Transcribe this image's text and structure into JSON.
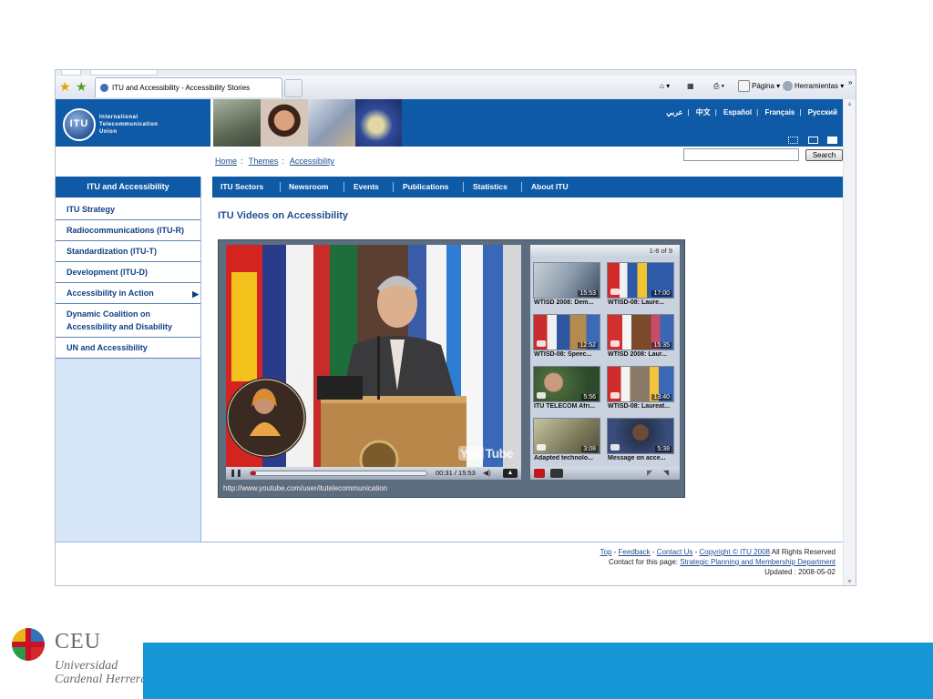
{
  "browser": {
    "tab_title": "ITU and Accessibility - Accessibility Stories",
    "commands": {
      "home": "⌂",
      "feeds": "▦",
      "print": "⎙",
      "page": "Página",
      "tools": "Herramientas",
      "more": "»"
    }
  },
  "itu": {
    "org_name_lines": [
      "International",
      "Telecommunication",
      "Union"
    ],
    "logo_text": "ITU",
    "languages": [
      "عربي",
      "中文",
      "Español",
      "Français",
      "Русский"
    ],
    "search": {
      "placeholder": "",
      "button": "Search"
    },
    "breadcrumb": [
      "Home",
      "Themes",
      "Accessibility"
    ],
    "left_nav": {
      "heading": "ITU and Accessibility",
      "items": [
        "ITU Strategy",
        "Radiocommunications (ITU-R)",
        "Standardization (ITU-T)",
        "Development (ITU-D)",
        "Accessibility in Action",
        "Dynamic Coalition on Accessibility and Disability",
        "UN and Accessibility"
      ]
    },
    "top_nav": [
      "ITU Sectors",
      "Newsroom",
      "Events",
      "Publications",
      "Statistics",
      "About ITU"
    ],
    "page_title": "ITU Videos on Accessibility"
  },
  "player": {
    "time": "00:31 / 15:53",
    "progress": 0.03,
    "brand": "You",
    "brand2": "Tube",
    "url": "http://www.youtube.com/user/itutelecommunication",
    "playlist_count": "1-8 of 9",
    "videos": [
      {
        "caption": "WTISD 2008: Dem...",
        "duration": "15:53"
      },
      {
        "caption": "WTISD-08: Laure...",
        "duration": "17:00"
      },
      {
        "caption": "WTISD-08: Speec...",
        "duration": "12:52"
      },
      {
        "caption": "WTISD 2008: Laur...",
        "duration": "15:35"
      },
      {
        "caption": "ITU TELECOM Afri...",
        "duration": "5:56"
      },
      {
        "caption": "WTISD-08: Laureat...",
        "duration": "13:40"
      },
      {
        "caption": "Adapted technolo...",
        "duration": "3:08"
      },
      {
        "caption": "Message on acce...",
        "duration": "5:38"
      }
    ]
  },
  "footer": {
    "links": [
      "Top",
      "Feedback",
      "Contact Us",
      "Copyright © ITU 2008"
    ],
    "rights": "All Rights Reserved",
    "contact_label": "Contact for this page:",
    "contact_link": "Strategic Planning and Membership Department",
    "updated": "Updated : 2008-05-02"
  },
  "slide": {
    "logo_name": "CEU",
    "logo_sub1": "Universidad",
    "logo_sub2": "Cardenal Herrera",
    "bar_color": "#1497d4"
  }
}
